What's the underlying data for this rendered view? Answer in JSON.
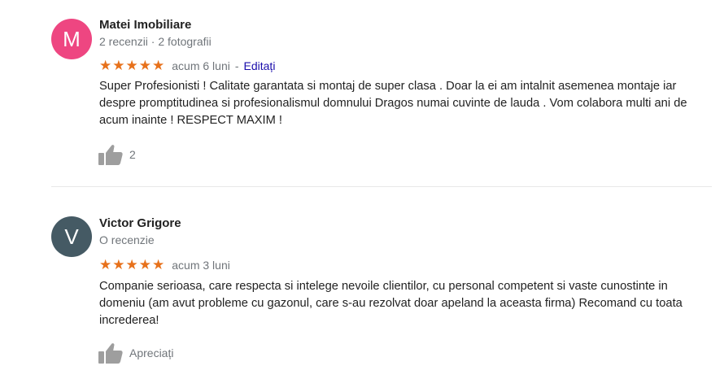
{
  "reviews": [
    {
      "avatar_letter": "M",
      "avatar_color": "#ee4681",
      "author": "Matei Imobiliare",
      "meta": "2 recenzii · 2 fotografii",
      "rating": 5,
      "date": "acum 6 luni",
      "separator": "-",
      "edited": "Editați",
      "text": "Super Profesionisti ! Calitate garantata si montaj de super clasa . Doar la ei am intalnit asemenea montaje iar despre promptitudinea si profesionalismul domnului Dragos numai cuvinte de lauda . Vom colabora multi ani de acum inainte ! RESPECT MAXIM !",
      "likes": "2"
    },
    {
      "avatar_letter": "V",
      "avatar_color": "#455a64",
      "author": "Victor Grigore",
      "meta": "O recenzie",
      "rating": 5,
      "date": "acum 3 luni",
      "text": "Companie serioasa, care respecta si intelege nevoile clientilor, cu personal competent si vaste cunostinte in domeniu (am avut probleme cu gazonul, care s-au rezolvat doar apeland la aceasta firma) Recomand cu toata increderea!",
      "likes": "Apreciați"
    }
  ],
  "colors": {
    "star": "#e7711b",
    "meta": "#70757a",
    "link": "#1a0dab",
    "thumb": "#9e9e9e"
  },
  "icons": {
    "star": "star-icon",
    "like": "thumbs-up-icon"
  }
}
